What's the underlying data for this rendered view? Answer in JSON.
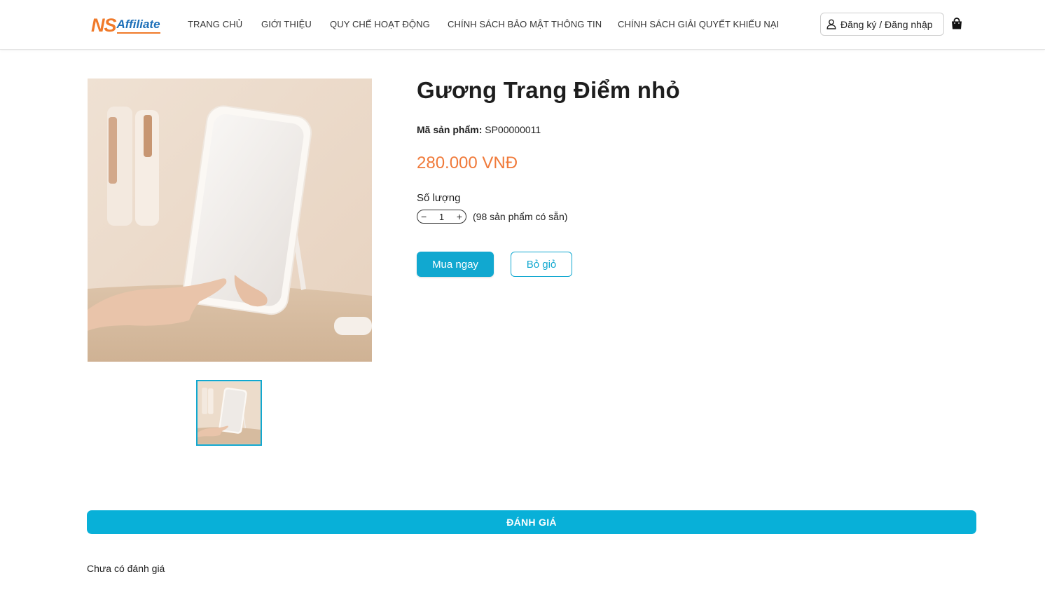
{
  "header": {
    "logo": {
      "ns": "NS",
      "affiliate": "Affiliate"
    },
    "nav": [
      {
        "label": "TRANG CHỦ"
      },
      {
        "label": "GIỚI THIỆU"
      },
      {
        "label": "QUY CHẾ HOẠT ĐỘNG"
      },
      {
        "label": "CHÍNH SÁCH BẢO MẬT THÔNG TIN"
      },
      {
        "label": "CHÍNH SÁCH GIẢI QUYẾT KHIẾU NẠI"
      }
    ],
    "login_label": "Đăng ký / Đăng nhập",
    "icons": {
      "user": "user-icon",
      "cart": "shopping-bag-icon"
    }
  },
  "product": {
    "title": "Gương Trang Điểm nhỏ",
    "sku_label": "Mã sản phẩm:",
    "sku_value": "SP00000011",
    "price": "280.000 VNĐ",
    "quantity_label": "Số lượng",
    "quantity_minus": "−",
    "quantity_value": "1",
    "quantity_plus": "+",
    "stock_text": "(98 sản phẩm có sẵn)",
    "buy_now_label": "Mua ngay",
    "add_to_cart_label": "Bỏ giỏ"
  },
  "reviews": {
    "heading": "ĐÁNH GIÁ",
    "empty_text": "Chưa có đánh giá"
  },
  "colors": {
    "accent": "#11a8d0",
    "price": "#f07a3a",
    "logo_orange": "#f07a2a",
    "logo_blue": "#1d6fb8"
  }
}
